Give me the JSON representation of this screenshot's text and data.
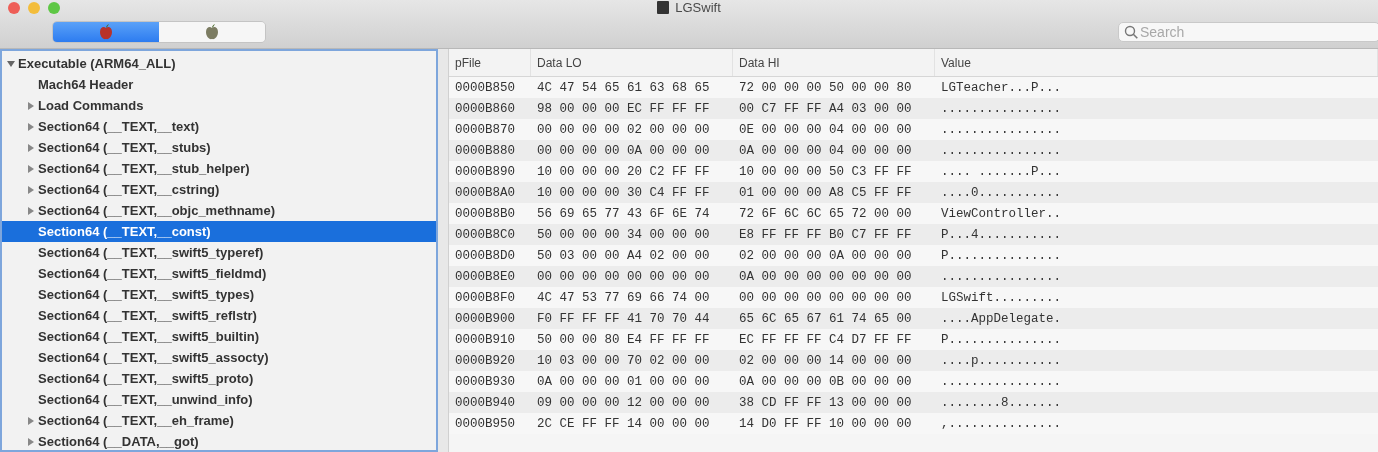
{
  "window": {
    "title": "LGSwift"
  },
  "toolbar": {
    "segments": [
      {
        "selected": true
      },
      {
        "selected": false
      }
    ],
    "search": {
      "placeholder": "Search"
    }
  },
  "tree": [
    {
      "label": "Executable  (ARM64_ALL)",
      "expanded": true,
      "selected": false,
      "children": [
        {
          "label": "Mach64 Header",
          "has_children": false,
          "selected": false
        },
        {
          "label": "Load Commands",
          "has_children": true,
          "selected": false
        },
        {
          "label": "Section64 (__TEXT,__text)",
          "has_children": true,
          "selected": false
        },
        {
          "label": "Section64 (__TEXT,__stubs)",
          "has_children": true,
          "selected": false
        },
        {
          "label": "Section64 (__TEXT,__stub_helper)",
          "has_children": true,
          "selected": false
        },
        {
          "label": "Section64 (__TEXT,__cstring)",
          "has_children": true,
          "selected": false
        },
        {
          "label": "Section64 (__TEXT,__objc_methname)",
          "has_children": true,
          "selected": false
        },
        {
          "label": "Section64 (__TEXT,__const)",
          "has_children": false,
          "selected": true
        },
        {
          "label": "Section64 (__TEXT,__swift5_typeref)",
          "has_children": false,
          "selected": false
        },
        {
          "label": "Section64 (__TEXT,__swift5_fieldmd)",
          "has_children": false,
          "selected": false
        },
        {
          "label": "Section64 (__TEXT,__swift5_types)",
          "has_children": false,
          "selected": false
        },
        {
          "label": "Section64 (__TEXT,__swift5_reflstr)",
          "has_children": false,
          "selected": false
        },
        {
          "label": "Section64 (__TEXT,__swift5_builtin)",
          "has_children": false,
          "selected": false
        },
        {
          "label": "Section64 (__TEXT,__swift5_assocty)",
          "has_children": false,
          "selected": false
        },
        {
          "label": "Section64 (__TEXT,__swift5_proto)",
          "has_children": false,
          "selected": false
        },
        {
          "label": "Section64 (__TEXT,__unwind_info)",
          "has_children": false,
          "selected": false
        },
        {
          "label": "Section64 (__TEXT,__eh_frame)",
          "has_children": true,
          "selected": false
        },
        {
          "label": "Section64 (__DATA,__got)",
          "has_children": true,
          "selected": false
        }
      ]
    }
  ],
  "table": {
    "columns": [
      "pFile",
      "Data LO",
      "Data HI",
      "Value"
    ],
    "rows": [
      {
        "pfile": "0000B850",
        "data_lo": "4C 47 54 65 61 63 68 65",
        "data_hi": "72 00 00 00 50 00 00 80",
        "value": "LGTeacher...P..."
      },
      {
        "pfile": "0000B860",
        "data_lo": "98 00 00 00 EC FF FF FF",
        "data_hi": "00 C7 FF FF A4 03 00 00",
        "value": "................"
      },
      {
        "pfile": "0000B870",
        "data_lo": "00 00 00 00 02 00 00 00",
        "data_hi": "0E 00 00 00 04 00 00 00",
        "value": "................"
      },
      {
        "pfile": "0000B880",
        "data_lo": "00 00 00 00 0A 00 00 00",
        "data_hi": "0A 00 00 00 04 00 00 00",
        "value": "................"
      },
      {
        "pfile": "0000B890",
        "data_lo": "10 00 00 00 20 C2 FF FF",
        "data_hi": "10 00 00 00 50 C3 FF FF",
        "value": ".... .......P..."
      },
      {
        "pfile": "0000B8A0",
        "data_lo": "10 00 00 00 30 C4 FF FF",
        "data_hi": "01 00 00 00 A8 C5 FF FF",
        "value": "....0..........."
      },
      {
        "pfile": "0000B8B0",
        "data_lo": "56 69 65 77 43 6F 6E 74",
        "data_hi": "72 6F 6C 6C 65 72 00 00",
        "value": "ViewController.."
      },
      {
        "pfile": "0000B8C0",
        "data_lo": "50 00 00 00 34 00 00 00",
        "data_hi": "E8 FF FF FF B0 C7 FF FF",
        "value": "P...4..........."
      },
      {
        "pfile": "0000B8D0",
        "data_lo": "50 03 00 00 A4 02 00 00",
        "data_hi": "02 00 00 00 0A 00 00 00",
        "value": "P..............."
      },
      {
        "pfile": "0000B8E0",
        "data_lo": "00 00 00 00 00 00 00 00",
        "data_hi": "0A 00 00 00 00 00 00 00",
        "value": "................"
      },
      {
        "pfile": "0000B8F0",
        "data_lo": "4C 47 53 77 69 66 74 00",
        "data_hi": "00 00 00 00 00 00 00 00",
        "value": "LGSwift........."
      },
      {
        "pfile": "0000B900",
        "data_lo": "F0 FF FF FF 41 70 70 44",
        "data_hi": "65 6C 65 67 61 74 65 00",
        "value": "....AppDelegate."
      },
      {
        "pfile": "0000B910",
        "data_lo": "50 00 00 80 E4 FF FF FF",
        "data_hi": "EC FF FF FF C4 D7 FF FF",
        "value": "P..............."
      },
      {
        "pfile": "0000B920",
        "data_lo": "10 03 00 00 70 02 00 00",
        "data_hi": "02 00 00 00 14 00 00 00",
        "value": "....p..........."
      },
      {
        "pfile": "0000B930",
        "data_lo": "0A 00 00 00 01 00 00 00",
        "data_hi": "0A 00 00 00 0B 00 00 00",
        "value": "................"
      },
      {
        "pfile": "0000B940",
        "data_lo": "09 00 00 00 12 00 00 00",
        "data_hi": "38 CD FF FF 13 00 00 00",
        "value": "........8......."
      },
      {
        "pfile": "0000B950",
        "data_lo": "2C CE FF FF 14 00 00 00",
        "data_hi": "14 D0 FF FF 10 00 00 00",
        "value": ",..............."
      }
    ]
  }
}
